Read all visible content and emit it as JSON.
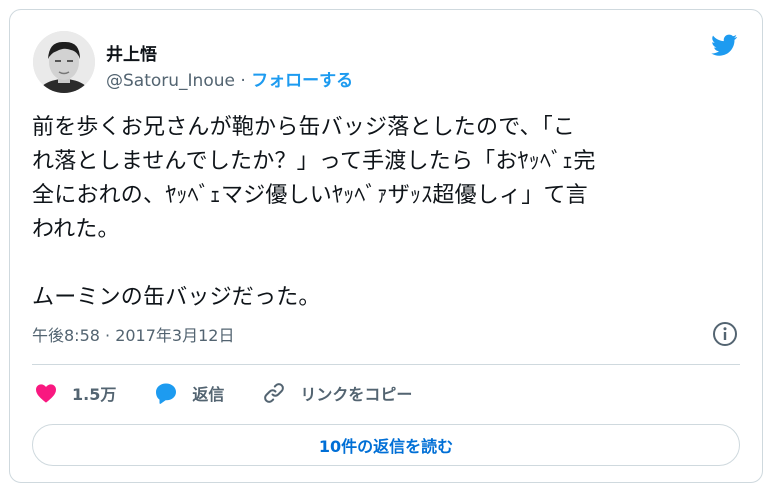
{
  "author": {
    "display_name": "井上悟",
    "handle": "@Satoru_Inoue",
    "separator": "·",
    "follow_label": "フォローする"
  },
  "tweet": {
    "text": "前を歩くお兄さんが鞄から缶バッジ落としたので、「こ\nれ落としませんでしたか？」って手渡したら「おﾔｯﾍﾞｪ完\n全におれの、ﾔｯﾍﾞｪマジ優しいﾔｯﾍﾞｧザｯｽ超優しィ」て言\nわれた。\n\nムーミンの缶バッジだった。",
    "timestamp": "午後8:58 · 2017年3月12日"
  },
  "actions": {
    "likes_count": "1.5万",
    "reply_label": "返信",
    "copy_link_label": "リンクをコピー"
  },
  "replies_button_label": "10件の返信を読む",
  "colors": {
    "accent": "#1d9bf0",
    "like": "#f91880",
    "text": "#0f1419",
    "muted": "#536471",
    "border": "#cfd9de"
  },
  "icons": [
    "twitter-bird-icon",
    "info-icon",
    "heart-icon",
    "reply-bubble-icon",
    "link-icon"
  ]
}
